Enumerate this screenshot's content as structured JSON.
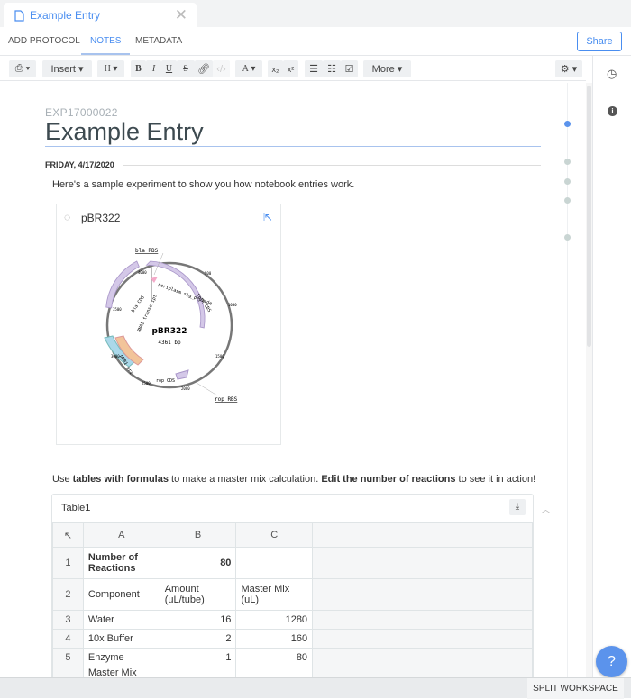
{
  "tab": {
    "title": "Example Entry",
    "icon": "document-icon"
  },
  "nav": {
    "items": [
      "ADD PROTOCOL",
      "NOTES",
      "METADATA"
    ],
    "active": "NOTES",
    "share": "Share"
  },
  "toolbar": {
    "insert": "Insert",
    "heading": "H",
    "bold": "B",
    "italic": "I",
    "underline": "U",
    "strike": "S",
    "font_color": "A",
    "sub": "x₂",
    "sup": "x²",
    "more": "More"
  },
  "entry": {
    "id": "EXP17000022",
    "title": "Example Entry",
    "date": "FRIDAY, 4/17/2020",
    "intro": "Here's a sample experiment to show you how notebook entries work."
  },
  "plasmid": {
    "name": "pBR322",
    "center_name": "pBR322",
    "length": "4361 bp",
    "labels": {
      "bla_rbs": "bla RBS",
      "rop_rbs": "rop RBS",
      "periplasm": "periplasm sig_peptide",
      "tetr": "tetR CDS",
      "bla": "bla CDS",
      "rna": "RNAI transcript",
      "pmb1": "pMB1 ori",
      "rop": "rop CDS"
    },
    "ticks": [
      "500",
      "1000",
      "1500",
      "2000",
      "2500",
      "3000",
      "3500",
      "4000"
    ]
  },
  "text2": {
    "a": "Use ",
    "b": "tables with formulas",
    "c": " to make a master mix calculation. ",
    "d": "Edit the number of reactions",
    "e": " to see it in action!"
  },
  "table": {
    "name": "Table1",
    "columns": [
      "A",
      "B",
      "C"
    ],
    "rows": [
      {
        "n": "1",
        "a": "Number of Reactions",
        "b": "80",
        "c": ""
      },
      {
        "n": "2",
        "a": "Component",
        "b": "Amount (uL/tube)",
        "c": "Master Mix (uL)"
      },
      {
        "n": "3",
        "a": "Water",
        "b": "16",
        "c": "1280"
      },
      {
        "n": "4",
        "a": "10x Buffer",
        "b": "2",
        "c": "160"
      },
      {
        "n": "5",
        "a": "Enzyme",
        "b": "1",
        "c": "80"
      },
      {
        "n": "",
        "a": "Master Mix",
        "b": "",
        "c": ""
      }
    ]
  },
  "footer": {
    "split": "SPLIT WORKSPACE",
    "help": "?"
  }
}
